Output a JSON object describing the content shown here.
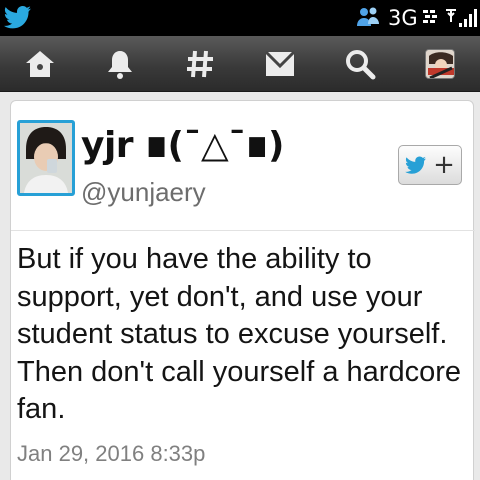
{
  "status_bar": {
    "app_icon": "twitter-bird-icon",
    "network_label": "3G",
    "icons": [
      "contacts-icon",
      "bbm-icon",
      "signal-bars-icon"
    ]
  },
  "nav": {
    "items": [
      {
        "name": "home",
        "icon": "home-icon"
      },
      {
        "name": "notifications",
        "icon": "bell-icon"
      },
      {
        "name": "discover",
        "icon": "hashtag-icon"
      },
      {
        "name": "messages",
        "icon": "envelope-icon"
      },
      {
        "name": "search",
        "icon": "search-icon"
      },
      {
        "name": "profile",
        "icon": "avatar-icon"
      }
    ]
  },
  "tweet": {
    "author": {
      "display_name": "yjr ∎(¯△¯∎)",
      "handle": "@yunjaery"
    },
    "text": "But if you have the ability to support, yet don't, and use your student status to excuse yourself. Then don't call yourself a hardcore fan.",
    "timestamp": "Jan 29, 2016 8:33p",
    "follow_button": {
      "icon": "twitter-bird-icon",
      "symbol": "+"
    }
  },
  "colors": {
    "status_bar": "#000000",
    "nav_bar": "#3a3a3a",
    "twitter_blue": "#27a0d6",
    "background": "#e9e9e9",
    "card": "#ffffff",
    "handle_gray": "#6d6d6d"
  }
}
